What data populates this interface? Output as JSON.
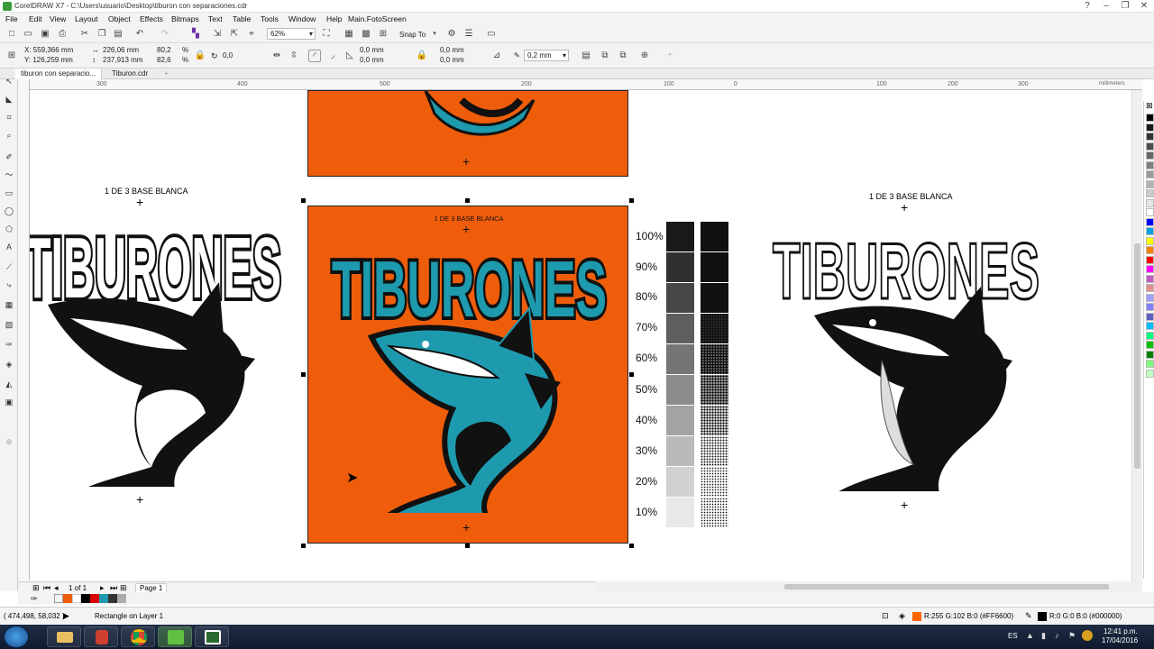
{
  "window": {
    "title": "CorelDRAW X7 - C:\\Users\\usuario\\Desktop\\tiburon con separaciones.cdr",
    "controls": [
      "?",
      "–",
      "❐",
      "✕"
    ]
  },
  "menu": [
    "File",
    "Edit",
    "View",
    "Layout",
    "Object",
    "Effects",
    "Bitmaps",
    "Text",
    "Table",
    "Tools",
    "Window",
    "Help",
    "Main.FotoScreen"
  ],
  "toolbar": {
    "zoom": "62%",
    "snap_to": "Snap To"
  },
  "property_bar": {
    "x": "X: 559,366 mm",
    "y": "Y: 126,259 mm",
    "width": "226,06 mm",
    "height": "237,913 mm",
    "scale_w": "80,2",
    "scale_h": "82,6",
    "percent": "%",
    "rotation": "0,0",
    "corner1": "0,0 mm",
    "corner2": "0,0 mm",
    "corner3": "0,0 mm",
    "corner4": "0,0 mm",
    "outline": "0,2 mm"
  },
  "doc_tabs": [
    "tiburon con separacio...",
    "Tiburon.cdr"
  ],
  "ruler_ticks": [
    "300",
    "400",
    "500",
    "200",
    "100",
    "0",
    "100",
    "200",
    "300"
  ],
  "ruler_unit": "millimeters",
  "canvas": {
    "labels": {
      "left": "1 DE 3 BASE BLANCA",
      "center": "1 DE 3 BASE BLANCA",
      "right": "1 DE 3 BASE BLANCA"
    },
    "artwork_text": "TIBURONES",
    "percent_scale": [
      "100%",
      "90%",
      "80%",
      "70%",
      "60%",
      "50%",
      "40%",
      "30%",
      "20%",
      "10%"
    ],
    "colors": {
      "orange": "#FF6600",
      "teal": "#1E9AAE",
      "black": "#111111"
    }
  },
  "page_bar": {
    "count": "1 of 1",
    "page": "Page 1"
  },
  "status": {
    "coords": "( 474,498, 58,032 )",
    "selection": "Rectangle on Layer 1",
    "fill": "R:255 G:102 B:0 (#FF6600)",
    "outline": "R:0 G:0 B:0 (#000000)"
  },
  "taskbar": {
    "lang": "ES",
    "time": "12:41 p.m.",
    "date": "17/04/2016"
  },
  "palette_colors": [
    "#000000",
    "#1a1a1a",
    "#333333",
    "#4d4d4d",
    "#666666",
    "#808080",
    "#999999",
    "#b3b3b3",
    "#cccccc",
    "#e6e6e6",
    "#ffffff",
    "#0000ff",
    "#00a0e0",
    "#ffff00",
    "#ff8000",
    "#ff0000",
    "#ff00ff",
    "#c060c0",
    "#e09090",
    "#a0a0ff",
    "#8080ff",
    "#6060c0",
    "#00c0ff",
    "#00ff80",
    "#00c000",
    "#008000",
    "#80ff80",
    "#c0ffc0"
  ]
}
